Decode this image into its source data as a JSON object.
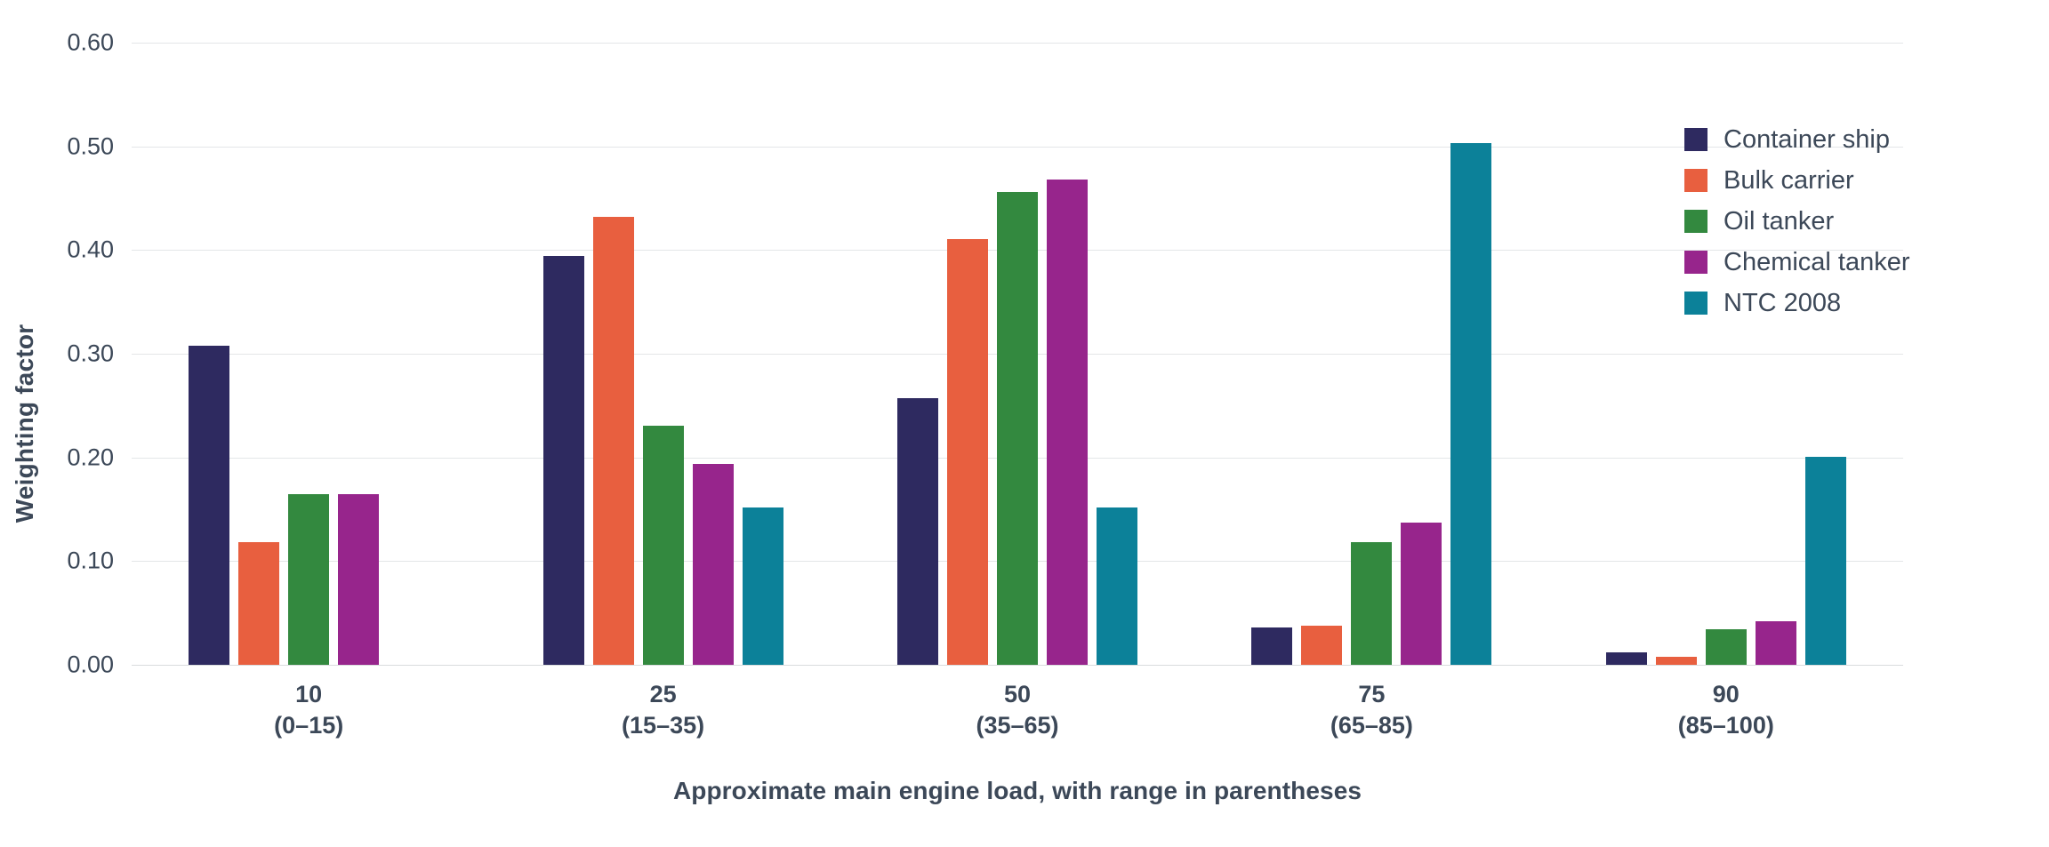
{
  "chart_data": {
    "type": "bar",
    "title": "",
    "subtitle": "",
    "xlabel": "Approximate main engine load, with range in parentheses",
    "ylabel": "Weighting factor",
    "categories": [
      "10",
      "25",
      "50",
      "75",
      "90"
    ],
    "category_ranges": [
      "(0–15)",
      "(15–35)",
      "(35–65)",
      "(65–85)",
      "(85–100)"
    ],
    "series": [
      {
        "name": "Container ship",
        "color": "#2e2a60",
        "values": [
          0.308,
          0.394,
          0.257,
          0.036,
          0.012
        ]
      },
      {
        "name": "Bulk carrier",
        "color": "#e85f3f",
        "values": [
          0.118,
          0.432,
          0.411,
          0.038,
          0.008
        ]
      },
      {
        "name": "Oil tanker",
        "color": "#33893f",
        "values": [
          0.165,
          0.231,
          0.456,
          0.118,
          0.034
        ]
      },
      {
        "name": "Chemical tanker",
        "color": "#97258c",
        "values": [
          0.165,
          0.194,
          0.468,
          0.137,
          0.042
        ]
      },
      {
        "name": "NTC 2008",
        "color": "#0c8199",
        "values": [
          null,
          0.152,
          0.152,
          0.503,
          0.201
        ]
      }
    ],
    "ylim": [
      0.0,
      0.6
    ],
    "yticks": [
      0.0,
      0.1,
      0.2,
      0.3,
      0.4,
      0.5,
      0.6
    ],
    "ytick_labels": [
      "0.00",
      "0.10",
      "0.20",
      "0.30",
      "0.40",
      "0.50",
      "0.60"
    ],
    "grid": true,
    "legend_position": "right",
    "orientation": "vertical",
    "background_color": "#ffffff",
    "text_color": "#3c4858",
    "gridline_color": "#e4e6e8"
  }
}
